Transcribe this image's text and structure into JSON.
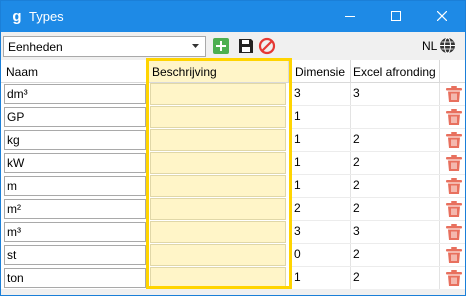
{
  "window": {
    "title": "Types",
    "title_bar_color": "#1e8ae6"
  },
  "toolbar": {
    "selector_value": "Eenheden",
    "language": "NL"
  },
  "table": {
    "headers": {
      "naam": "Naam",
      "beschrijving": "Beschrijving",
      "dimensie": "Dimensie",
      "excel": "Excel afronding"
    },
    "highlight_color": "#ffd400",
    "rows": [
      {
        "naam": "dm³",
        "beschrijving": "",
        "dimensie": "3",
        "excel": "3"
      },
      {
        "naam": "GP",
        "beschrijving": "",
        "dimensie": "1",
        "excel": ""
      },
      {
        "naam": "kg",
        "beschrijving": "",
        "dimensie": "1",
        "excel": "2"
      },
      {
        "naam": "kW",
        "beschrijving": "",
        "dimensie": "1",
        "excel": "2"
      },
      {
        "naam": "m",
        "beschrijving": "",
        "dimensie": "1",
        "excel": "2"
      },
      {
        "naam": "m²",
        "beschrijving": "",
        "dimensie": "2",
        "excel": "2"
      },
      {
        "naam": "m³",
        "beschrijving": "",
        "dimensie": "3",
        "excel": "3"
      },
      {
        "naam": "st",
        "beschrijving": "",
        "dimensie": "0",
        "excel": "2"
      },
      {
        "naam": "ton",
        "beschrijving": "",
        "dimensie": "1",
        "excel": "2"
      }
    ]
  },
  "icons": {
    "app": "app-icon",
    "minimize": "minimize-icon",
    "maximize": "maximize-icon",
    "close": "close-icon",
    "add": "add-icon",
    "save": "save-icon",
    "cancel": "cancel-icon",
    "globe": "globe-icon",
    "delete": "trash-icon"
  }
}
